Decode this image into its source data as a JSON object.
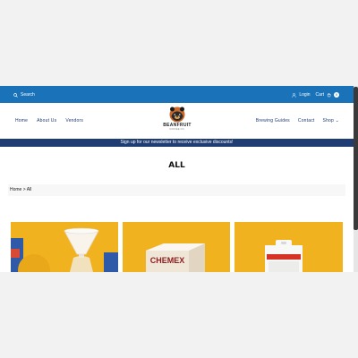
{
  "header": {
    "search_label": "Search",
    "login_label": "Login",
    "cart_label": "Cart",
    "cart_count": "0"
  },
  "nav": {
    "left": [
      "Home",
      "About Us",
      "Vendors"
    ],
    "right": [
      "Brewing Guides",
      "Contact",
      "Shop"
    ]
  },
  "logo": {
    "name": "BEANFRUIT",
    "tagline": "COFFEE CO."
  },
  "banner": {
    "text": "Sign up for our newsletter to receive exclusive discounts!"
  },
  "page": {
    "title": "ALL",
    "breadcrumb": "Home > All"
  },
  "products": {
    "card_2_label": "CHEMEX"
  },
  "colors": {
    "topbar": "#1a73b8",
    "navy": "#1f3d73",
    "product_bg": "#f0b21f"
  }
}
